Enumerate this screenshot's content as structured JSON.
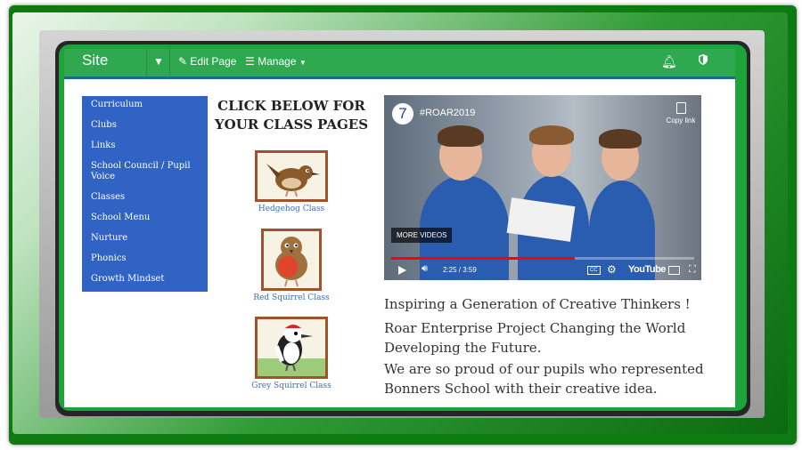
{
  "navbar": {
    "site": "Site",
    "edit_page": "Edit Page",
    "manage": "Manage",
    "bell_icon": "bell-icon",
    "shield_icon": "shield-icon"
  },
  "sidebar": {
    "items": [
      {
        "label": "Curriculum"
      },
      {
        "label": "Clubs"
      },
      {
        "label": "Links"
      },
      {
        "label": "School Council / Pupil Voice"
      },
      {
        "label": "Classes"
      },
      {
        "label": "School Menu"
      },
      {
        "label": "Nurture"
      },
      {
        "label": "Phonics"
      },
      {
        "label": "Growth Mindset"
      }
    ]
  },
  "classes": {
    "heading": "CLICK BELOW FOR YOUR CLASS PAGES",
    "items": [
      {
        "label": "Hedgehog Class"
      },
      {
        "label": "Red Squirrel Class"
      },
      {
        "label": "Grey Squirrel Class"
      }
    ]
  },
  "video": {
    "channel_number": "7",
    "title": "#ROAR2019",
    "copy_link": "Copy link",
    "more_videos": "MORE VIDEOS",
    "time": "2:25 / 3:59",
    "progress_fraction": 0.605,
    "cc": "CC",
    "brand": "YouTube"
  },
  "content": {
    "line1": "Inspiring a Generation of Creative Thinkers !",
    "line2": "Roar Enterprise Project Changing the World Developing the Future.",
    "line3": "We are so proud of our pupils who represented Bonners School with their creative idea."
  },
  "colors": {
    "nav_green": "#2fa84f",
    "menu_blue": "#3063c4",
    "frame_green": "#0d7a12",
    "link_blue": "#3a6fb0"
  }
}
